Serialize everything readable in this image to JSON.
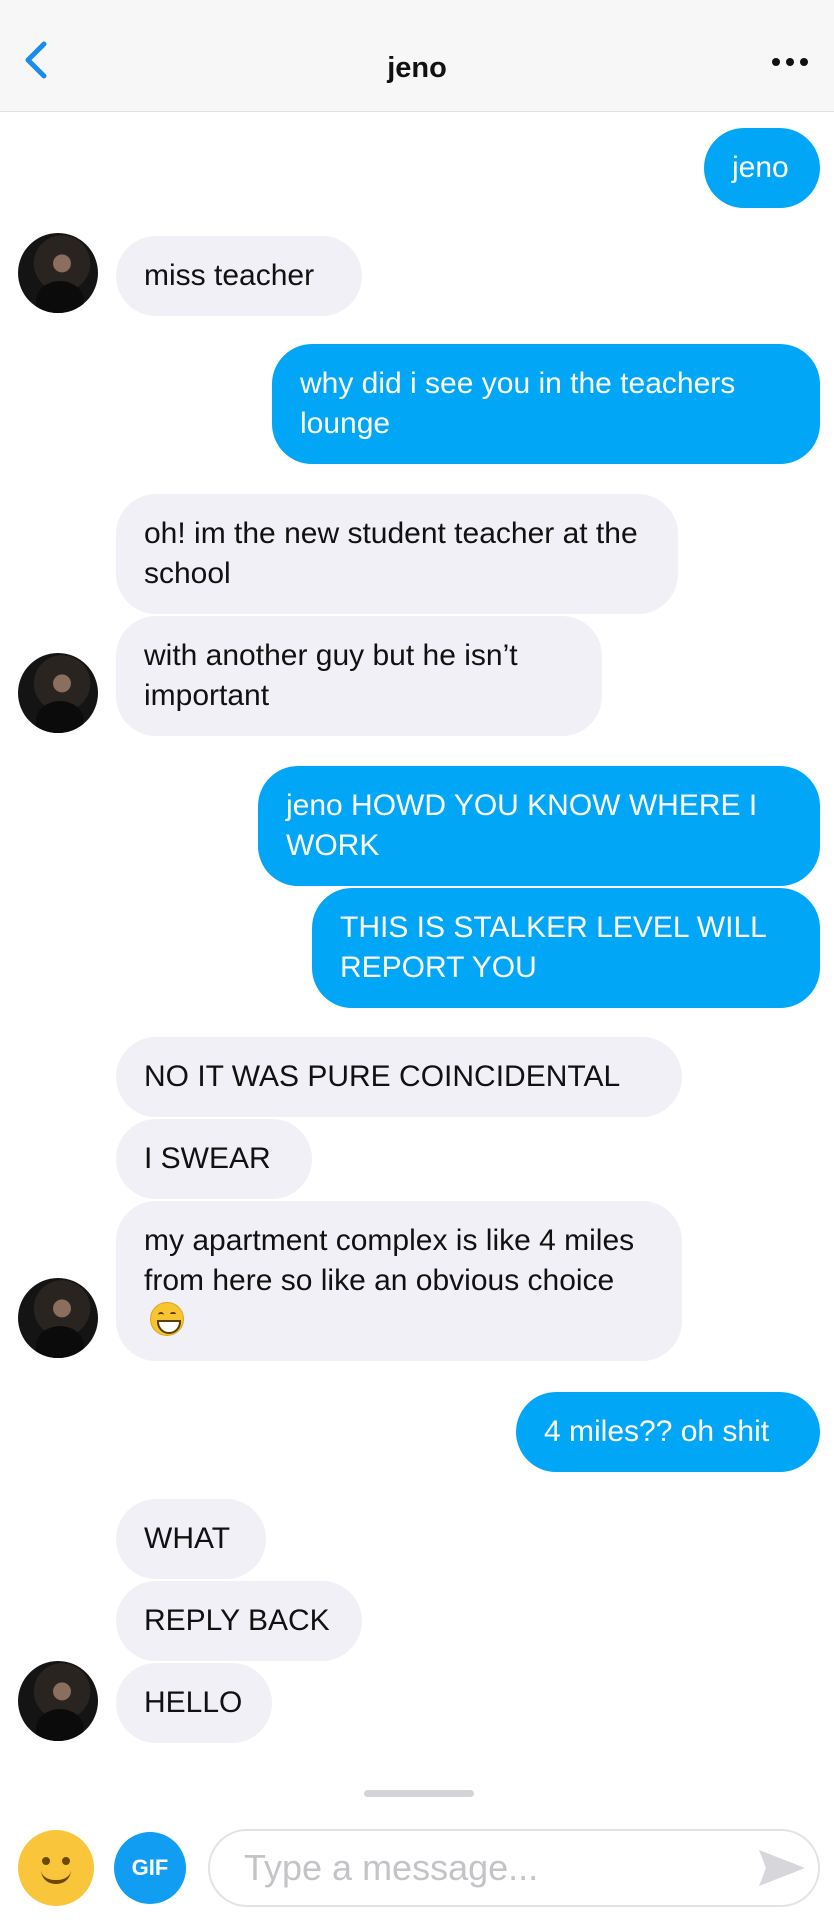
{
  "header": {
    "title": "jeno"
  },
  "messages": [
    {
      "from": "me",
      "text": "jeno"
    },
    {
      "from": "them",
      "text": "miss teacher"
    },
    {
      "from": "me",
      "text": "why did i see you in the teachers lounge"
    },
    {
      "from": "them",
      "text": "oh! im the new student teacher at the school"
    },
    {
      "from": "them",
      "text": "with another guy but he isn’t important"
    },
    {
      "from": "me",
      "text": "jeno HOWD YOU KNOW WHERE I WORK"
    },
    {
      "from": "me",
      "text": "THIS IS STALKER LEVEL WILL REPORT YOU"
    },
    {
      "from": "them",
      "text": "NO IT WAS PURE COINCIDENTAL"
    },
    {
      "from": "them",
      "text": "I SWEAR"
    },
    {
      "from": "them",
      "text": "my apartment complex is like 4 miles from here so like an obvious choice",
      "emoji": "grinning-face-emoji"
    },
    {
      "from": "me",
      "text": "4 miles?? oh shit"
    },
    {
      "from": "them",
      "text": "WHAT"
    },
    {
      "from": "them",
      "text": "REPLY BACK"
    },
    {
      "from": "them",
      "text": "HELLO"
    }
  ],
  "composer": {
    "gif_label": "GIF",
    "placeholder": "Type a message..."
  },
  "colors": {
    "outgoing_bubble": "#02a6f7",
    "incoming_bubble": "#f0f0f6",
    "accent_blue": "#1a8cf0",
    "gif_button": "#109df2",
    "emoji_button": "#f9c53b"
  },
  "icons": [
    "chevron-left-icon",
    "more-dots-icon",
    "smiley-icon",
    "send-arrow-icon"
  ]
}
